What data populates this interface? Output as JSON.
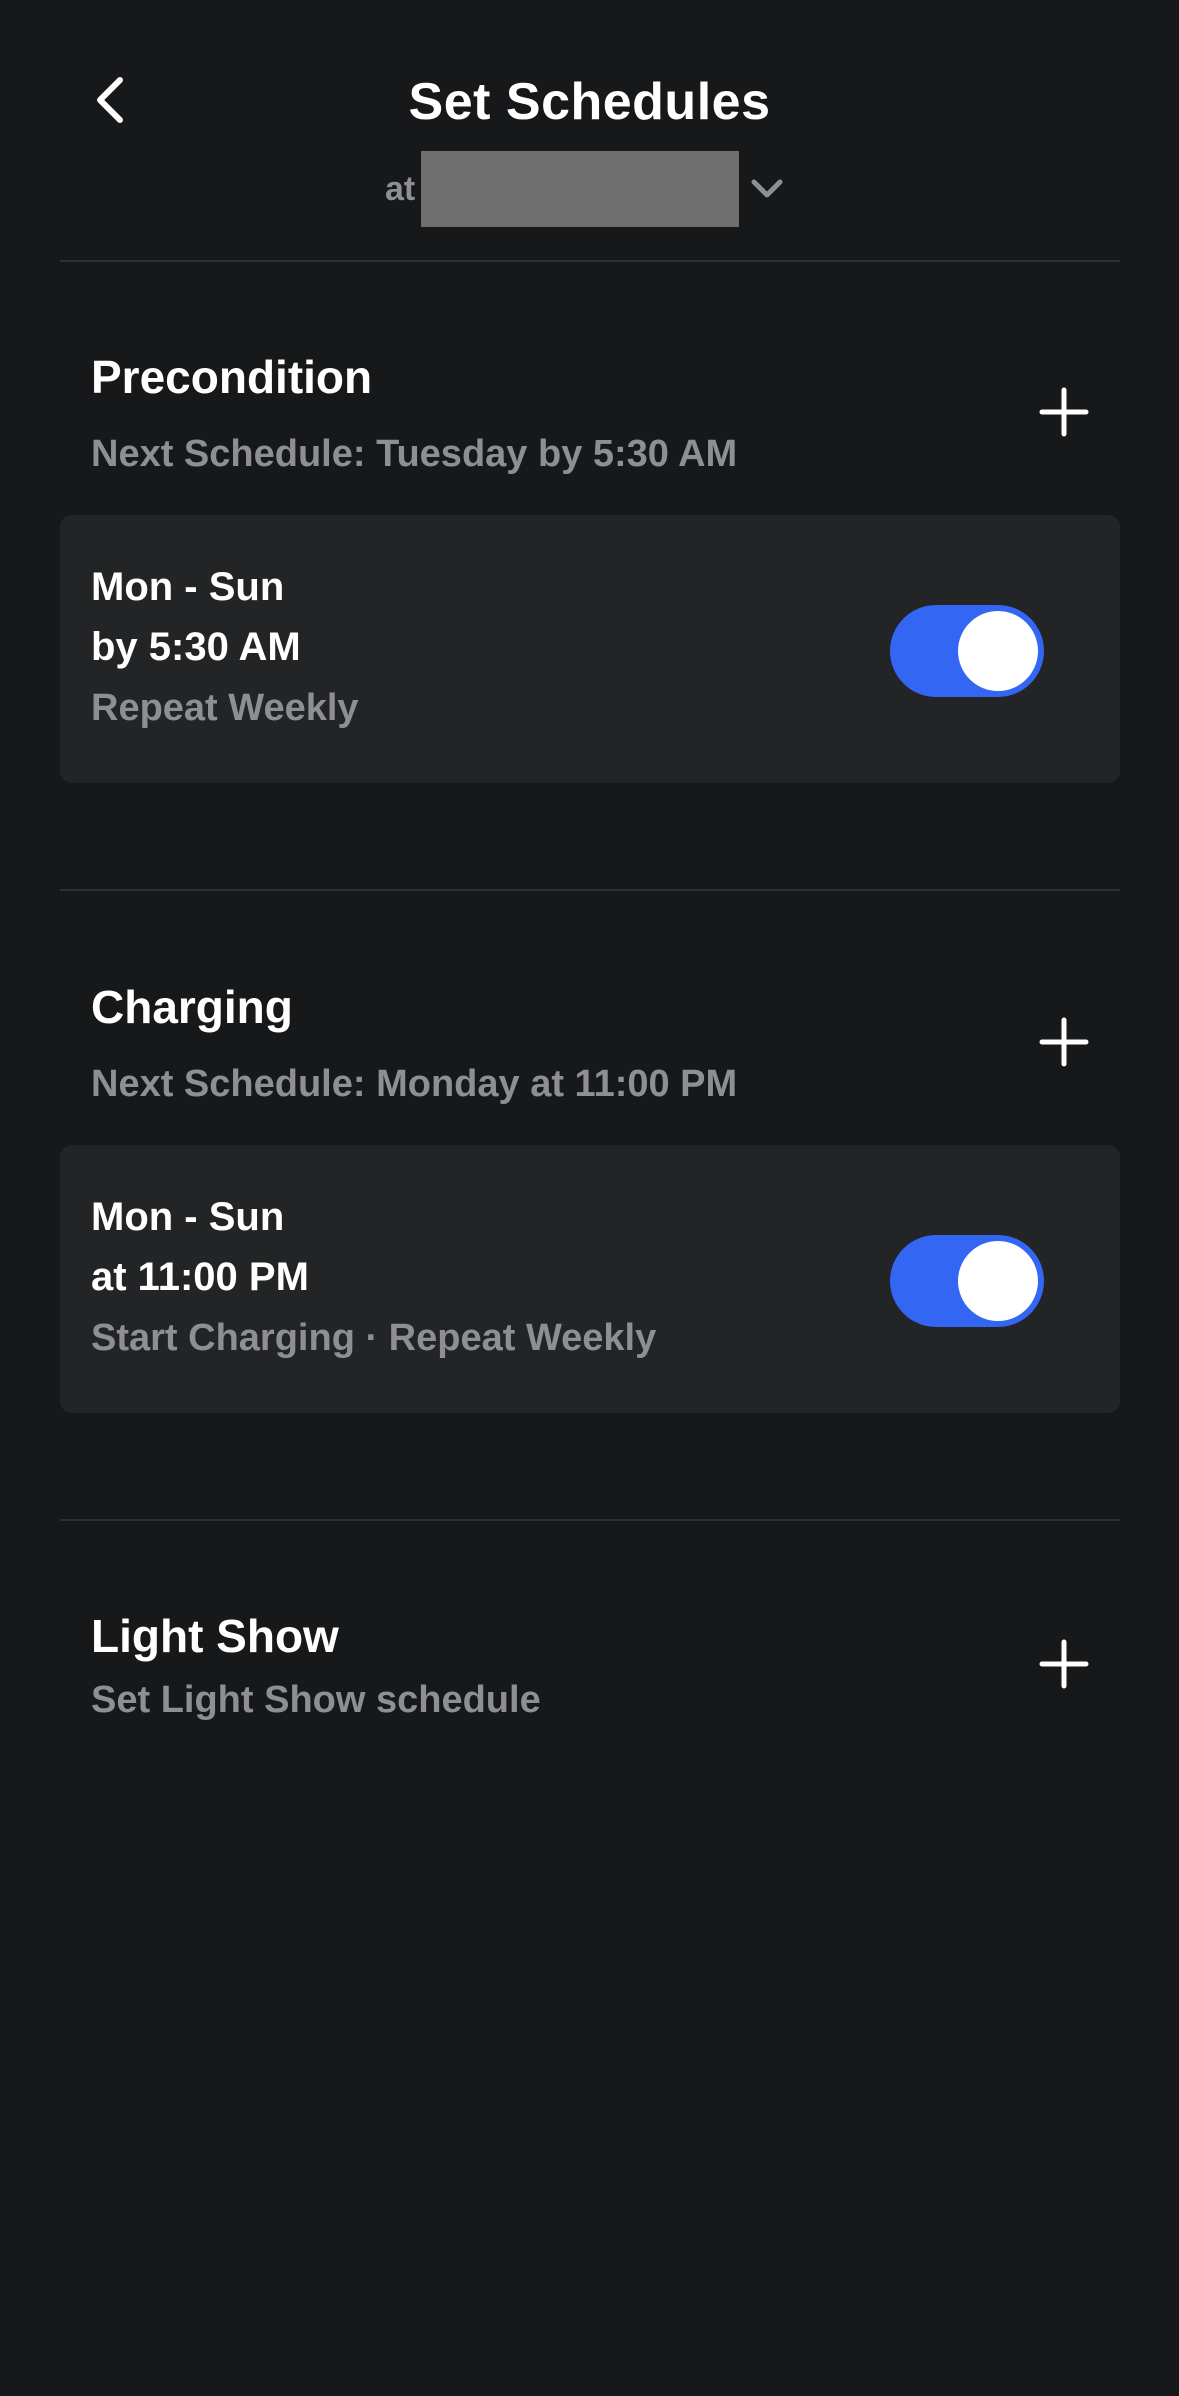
{
  "header": {
    "title": "Set Schedules",
    "location_prefix": "at"
  },
  "sections": [
    {
      "title": "Precondition",
      "subtitle": "Next Schedule: Tuesday by 5:30 AM",
      "schedules": [
        {
          "days": "Mon - Sun",
          "time": "by 5:30 AM",
          "detail": "Repeat Weekly",
          "enabled": true
        }
      ]
    },
    {
      "title": "Charging",
      "subtitle": "Next Schedule: Monday at 11:00 PM",
      "schedules": [
        {
          "days": "Mon - Sun",
          "time": "at 11:00 PM",
          "detail": "Start Charging · Repeat Weekly",
          "enabled": true
        }
      ]
    },
    {
      "title": "Light Show",
      "subtitle": "Set Light Show schedule",
      "schedules": []
    }
  ],
  "icons": {
    "back": "chevron-left-icon",
    "location_dropdown": "chevron-down-icon",
    "add": "plus-icon"
  },
  "colors": {
    "background": "#17181a",
    "card": "#232426",
    "accent": "#3366f2",
    "secondary_text": "#8e8f92"
  }
}
